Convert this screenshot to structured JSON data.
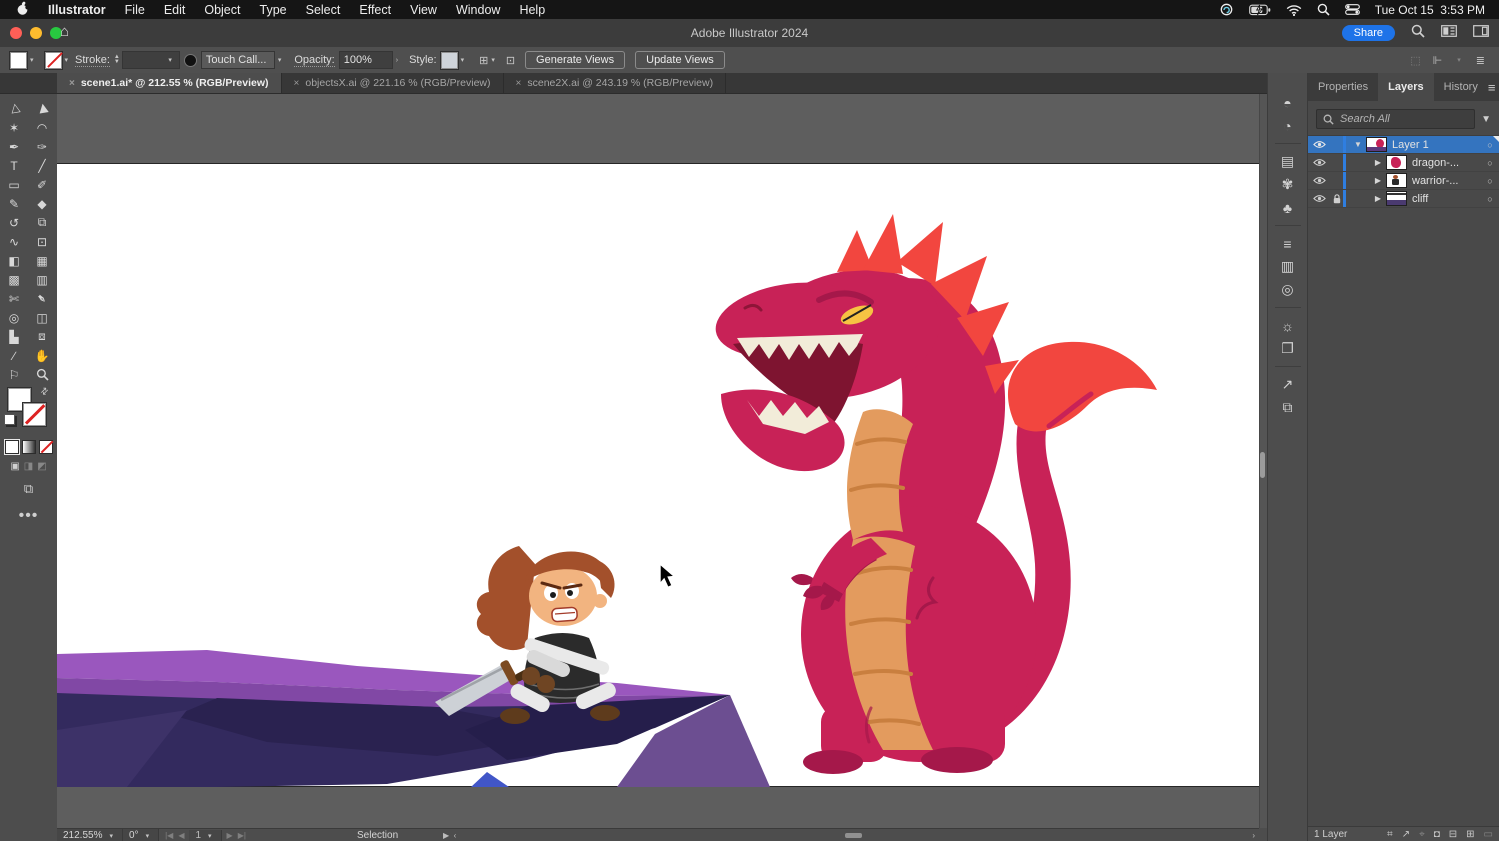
{
  "menubar": {
    "items": [
      "Illustrator",
      "File",
      "Edit",
      "Object",
      "Type",
      "Select",
      "Effect",
      "View",
      "Window",
      "Help"
    ],
    "time": "Tue Oct 15  3:53 PM"
  },
  "titlebar": {
    "title": "Adobe Illustrator 2024",
    "share_label": "Share"
  },
  "controlbar": {
    "stroke_label": "Stroke:",
    "brush_name": "Touch Call...",
    "opacity_label": "Opacity:",
    "opacity_value": "100%",
    "style_label": "Style:",
    "generate_views_label": "Generate Views",
    "update_views_label": "Update Views"
  },
  "document_tabs": [
    {
      "label": "scene1.ai* @ 212.55 % (RGB/Preview)",
      "active": true
    },
    {
      "label": "objectsX.ai @ 221.16 % (RGB/Preview)",
      "active": false
    },
    {
      "label": "scene2X.ai @ 243.19 % (RGB/Preview)",
      "active": false
    }
  ],
  "tools": [
    {
      "name": "selection-tool",
      "glyph": "▷"
    },
    {
      "name": "direct-selection-tool",
      "glyph": "▶"
    },
    {
      "name": "magic-wand-tool",
      "glyph": "✶"
    },
    {
      "name": "lasso-tool",
      "glyph": "◠"
    },
    {
      "name": "pen-tool",
      "glyph": "✒"
    },
    {
      "name": "curvature-tool",
      "glyph": "✑"
    },
    {
      "name": "type-tool",
      "glyph": "T"
    },
    {
      "name": "line-segment-tool",
      "glyph": "╱"
    },
    {
      "name": "rectangle-tool",
      "glyph": "▭"
    },
    {
      "name": "paintbrush-tool",
      "glyph": "✐"
    },
    {
      "name": "shaper-tool",
      "glyph": "✎"
    },
    {
      "name": "eraser-tool",
      "glyph": "◆"
    },
    {
      "name": "rotate-tool",
      "glyph": "↺"
    },
    {
      "name": "scale-tool",
      "glyph": "⧉"
    },
    {
      "name": "width-tool",
      "glyph": "∿"
    },
    {
      "name": "free-transform-tool",
      "glyph": "⊡"
    },
    {
      "name": "shape-builder-tool",
      "glyph": "◧"
    },
    {
      "name": "perspective-grid-tool",
      "glyph": "▦"
    },
    {
      "name": "mesh-tool",
      "glyph": "▩"
    },
    {
      "name": "gradient-tool",
      "glyph": "▥"
    },
    {
      "name": "slice-tool",
      "glyph": "✄"
    },
    {
      "name": "eyedropper-tool",
      "glyph": "✒"
    },
    {
      "name": "blend-tool",
      "glyph": "◎"
    },
    {
      "name": "symbol-sprayer-tool",
      "glyph": "◫"
    },
    {
      "name": "graph-tool",
      "glyph": "▙"
    },
    {
      "name": "artboard-tool",
      "glyph": "⧈"
    },
    {
      "name": "knife-tool",
      "glyph": "∕"
    },
    {
      "name": "hand-tool",
      "glyph": "✋"
    },
    {
      "name": "print-tiling-tool",
      "glyph": "⚐"
    },
    {
      "name": "zoom-tool",
      "glyph": "⌕"
    }
  ],
  "dock_icons": [
    {
      "name": "color-panel-icon",
      "glyph": "◓"
    },
    {
      "name": "color-guide-icon",
      "glyph": "◔"
    },
    {
      "name": "swatches-icon",
      "glyph": "▤"
    },
    {
      "name": "brushes-icon",
      "glyph": "✾"
    },
    {
      "name": "symbols-icon",
      "glyph": "♣"
    },
    {
      "name": "stroke-icon",
      "glyph": "≡"
    },
    {
      "name": "gradient-icon",
      "glyph": "▥"
    },
    {
      "name": "transparency-icon",
      "glyph": "◎"
    },
    {
      "name": "appearance-icon",
      "glyph": "☼"
    },
    {
      "name": "graphic-styles-icon",
      "glyph": "❐"
    },
    {
      "name": "export-icon",
      "glyph": "↗"
    },
    {
      "name": "artboards-icon",
      "glyph": "⧉"
    }
  ],
  "panel": {
    "tabs": [
      "Properties",
      "Layers",
      "History"
    ],
    "active_tab": "Layers",
    "search_placeholder": "Search All",
    "layers": [
      {
        "name": "Layer 1",
        "selected": true,
        "visible": true,
        "expanded": true,
        "locked": false
      },
      {
        "name": "dragon-...",
        "selected": false,
        "visible": true,
        "expanded": false,
        "locked": false
      },
      {
        "name": "warrior-...",
        "selected": false,
        "visible": true,
        "expanded": false,
        "locked": false
      },
      {
        "name": "cliff",
        "selected": false,
        "visible": true,
        "expanded": false,
        "locked": true
      }
    ],
    "footer_count": "1 Layer",
    "footer_icons": [
      {
        "name": "collect-export-icon",
        "glyph": "⌗"
      },
      {
        "name": "export-selection-icon",
        "glyph": "↗"
      },
      {
        "name": "locate-object-icon",
        "glyph": "⌖"
      },
      {
        "name": "make-clipping-mask-icon",
        "glyph": "◘"
      },
      {
        "name": "new-sublayer-icon",
        "glyph": "⊟"
      },
      {
        "name": "new-layer-icon",
        "glyph": "⊞"
      },
      {
        "name": "delete-layer-icon",
        "glyph": "▭"
      }
    ]
  },
  "statusbar": {
    "zoom": "212.55%",
    "rotation": "0°",
    "artboard_number": "1",
    "tool_name": "Selection"
  },
  "artwork": {
    "colors": {
      "dragon_body": "#C82257",
      "dragon_accent": "#A5184A",
      "dragon_spike": "#F2463F",
      "dragon_belly": "#E39B5E",
      "dragon_belly_line": "#C97F3F",
      "dragon_teeth": "#F2ECD9",
      "dragon_mouth": "#7E1430",
      "dragon_eye": "#F6C343",
      "warrior_hair": "#A3502B",
      "warrior_skin": "#F2B480",
      "warrior_tunic": "#2B2B2B",
      "warrior_sleeve": "#E9E9E9",
      "warrior_glove": "#6F4523",
      "warrior_boot": "#5E3B1C",
      "sword_blade": "#CDD1D6",
      "sword_guard": "#7C4A21",
      "cliff_surface": "#8148A5",
      "cliff_surface_light": "#9A57BE",
      "cliff_face": "#332A5E",
      "cliff_facet": "#2A2250",
      "cliff_facet_dark": "#251E4B",
      "cliff_wedge": "#6C4E91",
      "cliff_blue": "#4156C8"
    }
  }
}
